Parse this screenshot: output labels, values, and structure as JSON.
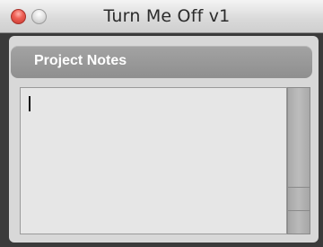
{
  "window": {
    "title": "Turn Me Off v1",
    "controls": {
      "close_icon": "close-icon",
      "minimize_icon": "minimize-icon"
    }
  },
  "panel": {
    "title": "Project Notes"
  },
  "notes": {
    "value": ""
  },
  "colors": {
    "window_frame": "#3b3b3b",
    "panel_header": "#999999",
    "notes_background": "#e6e6e6",
    "close_button": "#ee5f55"
  }
}
